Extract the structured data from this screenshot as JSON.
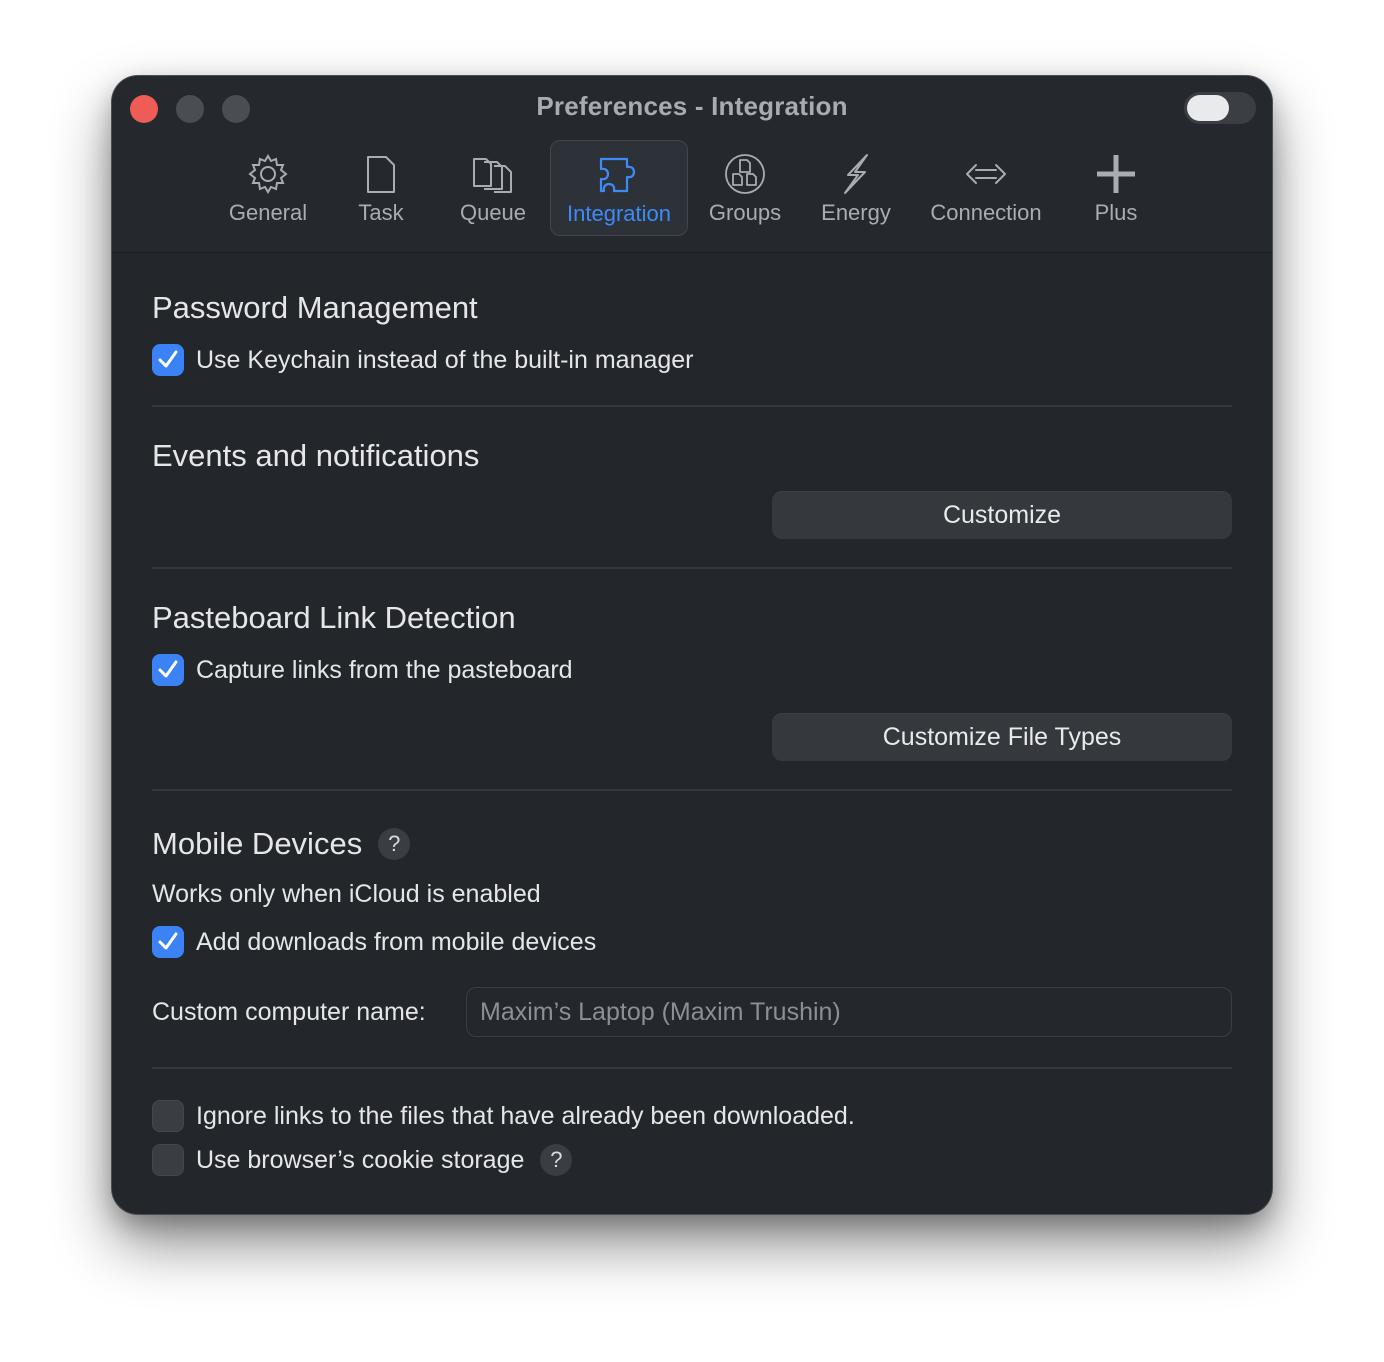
{
  "window": {
    "title": "Preferences - Integration"
  },
  "tabs": [
    {
      "label": "General",
      "icon": "gear-icon"
    },
    {
      "label": "Task",
      "icon": "document-icon"
    },
    {
      "label": "Queue",
      "icon": "stacked-documents-icon"
    },
    {
      "label": "Integration",
      "icon": "puzzle-piece-icon",
      "active": true
    },
    {
      "label": "Groups",
      "icon": "grouped-files-icon"
    },
    {
      "label": "Energy",
      "icon": "lightning-bolt-icon"
    },
    {
      "label": "Connection",
      "icon": "double-arrow-icon"
    },
    {
      "label": "Plus",
      "icon": "plus-icon"
    }
  ],
  "sections": {
    "password": {
      "title": "Password Management",
      "keychain_label": "Use Keychain instead of the built-in manager",
      "keychain_checked": true
    },
    "events": {
      "title": "Events and notifications",
      "customize_label": "Customize"
    },
    "pasteboard": {
      "title": "Pasteboard Link Detection",
      "capture_label": "Capture links from the pasteboard",
      "capture_checked": true,
      "file_types_label": "Customize File Types"
    },
    "mobile": {
      "title": "Mobile Devices",
      "help_symbol": "?",
      "note": "Works only when iCloud is enabled",
      "add_downloads_label": "Add downloads from mobile devices",
      "add_downloads_checked": true,
      "computer_name_label": "Custom computer name:",
      "computer_name_placeholder": "Maxim’s Laptop (Maxim Trushin)"
    },
    "misc": {
      "ignore_label": "Ignore links to the files that have already been downloaded.",
      "ignore_checked": false,
      "cookie_label": "Use browser’s cookie storage",
      "cookie_checked": false,
      "help_symbol": "?"
    }
  },
  "colors": {
    "accent": "#3d8bf7",
    "checkbox": "#3a82f6",
    "window_bg": "#23262a",
    "close_button": "#ee5c55"
  }
}
